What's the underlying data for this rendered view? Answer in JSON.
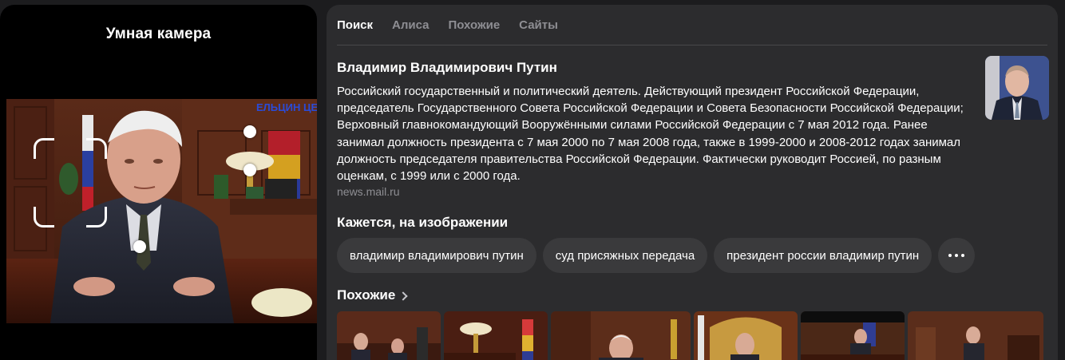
{
  "left_panel": {
    "title": "Умная камера"
  },
  "photo": {
    "watermark": "ЕЛЬЦИН ЦЕНТР"
  },
  "tabs": [
    {
      "label": "Поиск",
      "active": true
    },
    {
      "label": "Алиса",
      "active": false
    },
    {
      "label": "Похожие",
      "active": false
    },
    {
      "label": "Сайты",
      "active": false
    }
  ],
  "entity": {
    "name": "Владимир Владимирович Путин",
    "description": "Российский государственный и политический деятель. Действующий президент Российской Федерации, председатель Государственного Совета Российской Федерации и Совета Безопасности Российской Федерации; Верховный главнокомандующий Вооружёнными силами Российской Федерации с 7 мая 2012 года. Ранее занимал должность президента с 7 мая 2000 по 7 мая 2008 года, также в 1999-2000 и 2008-2012 годах занимал должность председателя правительства Российской Федерации. Фактически руководит Россией, по разным оценкам, с 1999 или с 2000 года.",
    "source": "news.mail.ru"
  },
  "recognition": {
    "title": "Кажется, на изображении",
    "chips": [
      "владимир владимирович путин",
      "суд присяжных передача",
      "президент россии владимир путин"
    ]
  },
  "similar": {
    "title": "Похожие"
  },
  "colors": {
    "background": "#1c1c1e",
    "panel": "#2c2c2e",
    "chip": "#3a3a3c",
    "muted_text": "#8e8e93"
  }
}
